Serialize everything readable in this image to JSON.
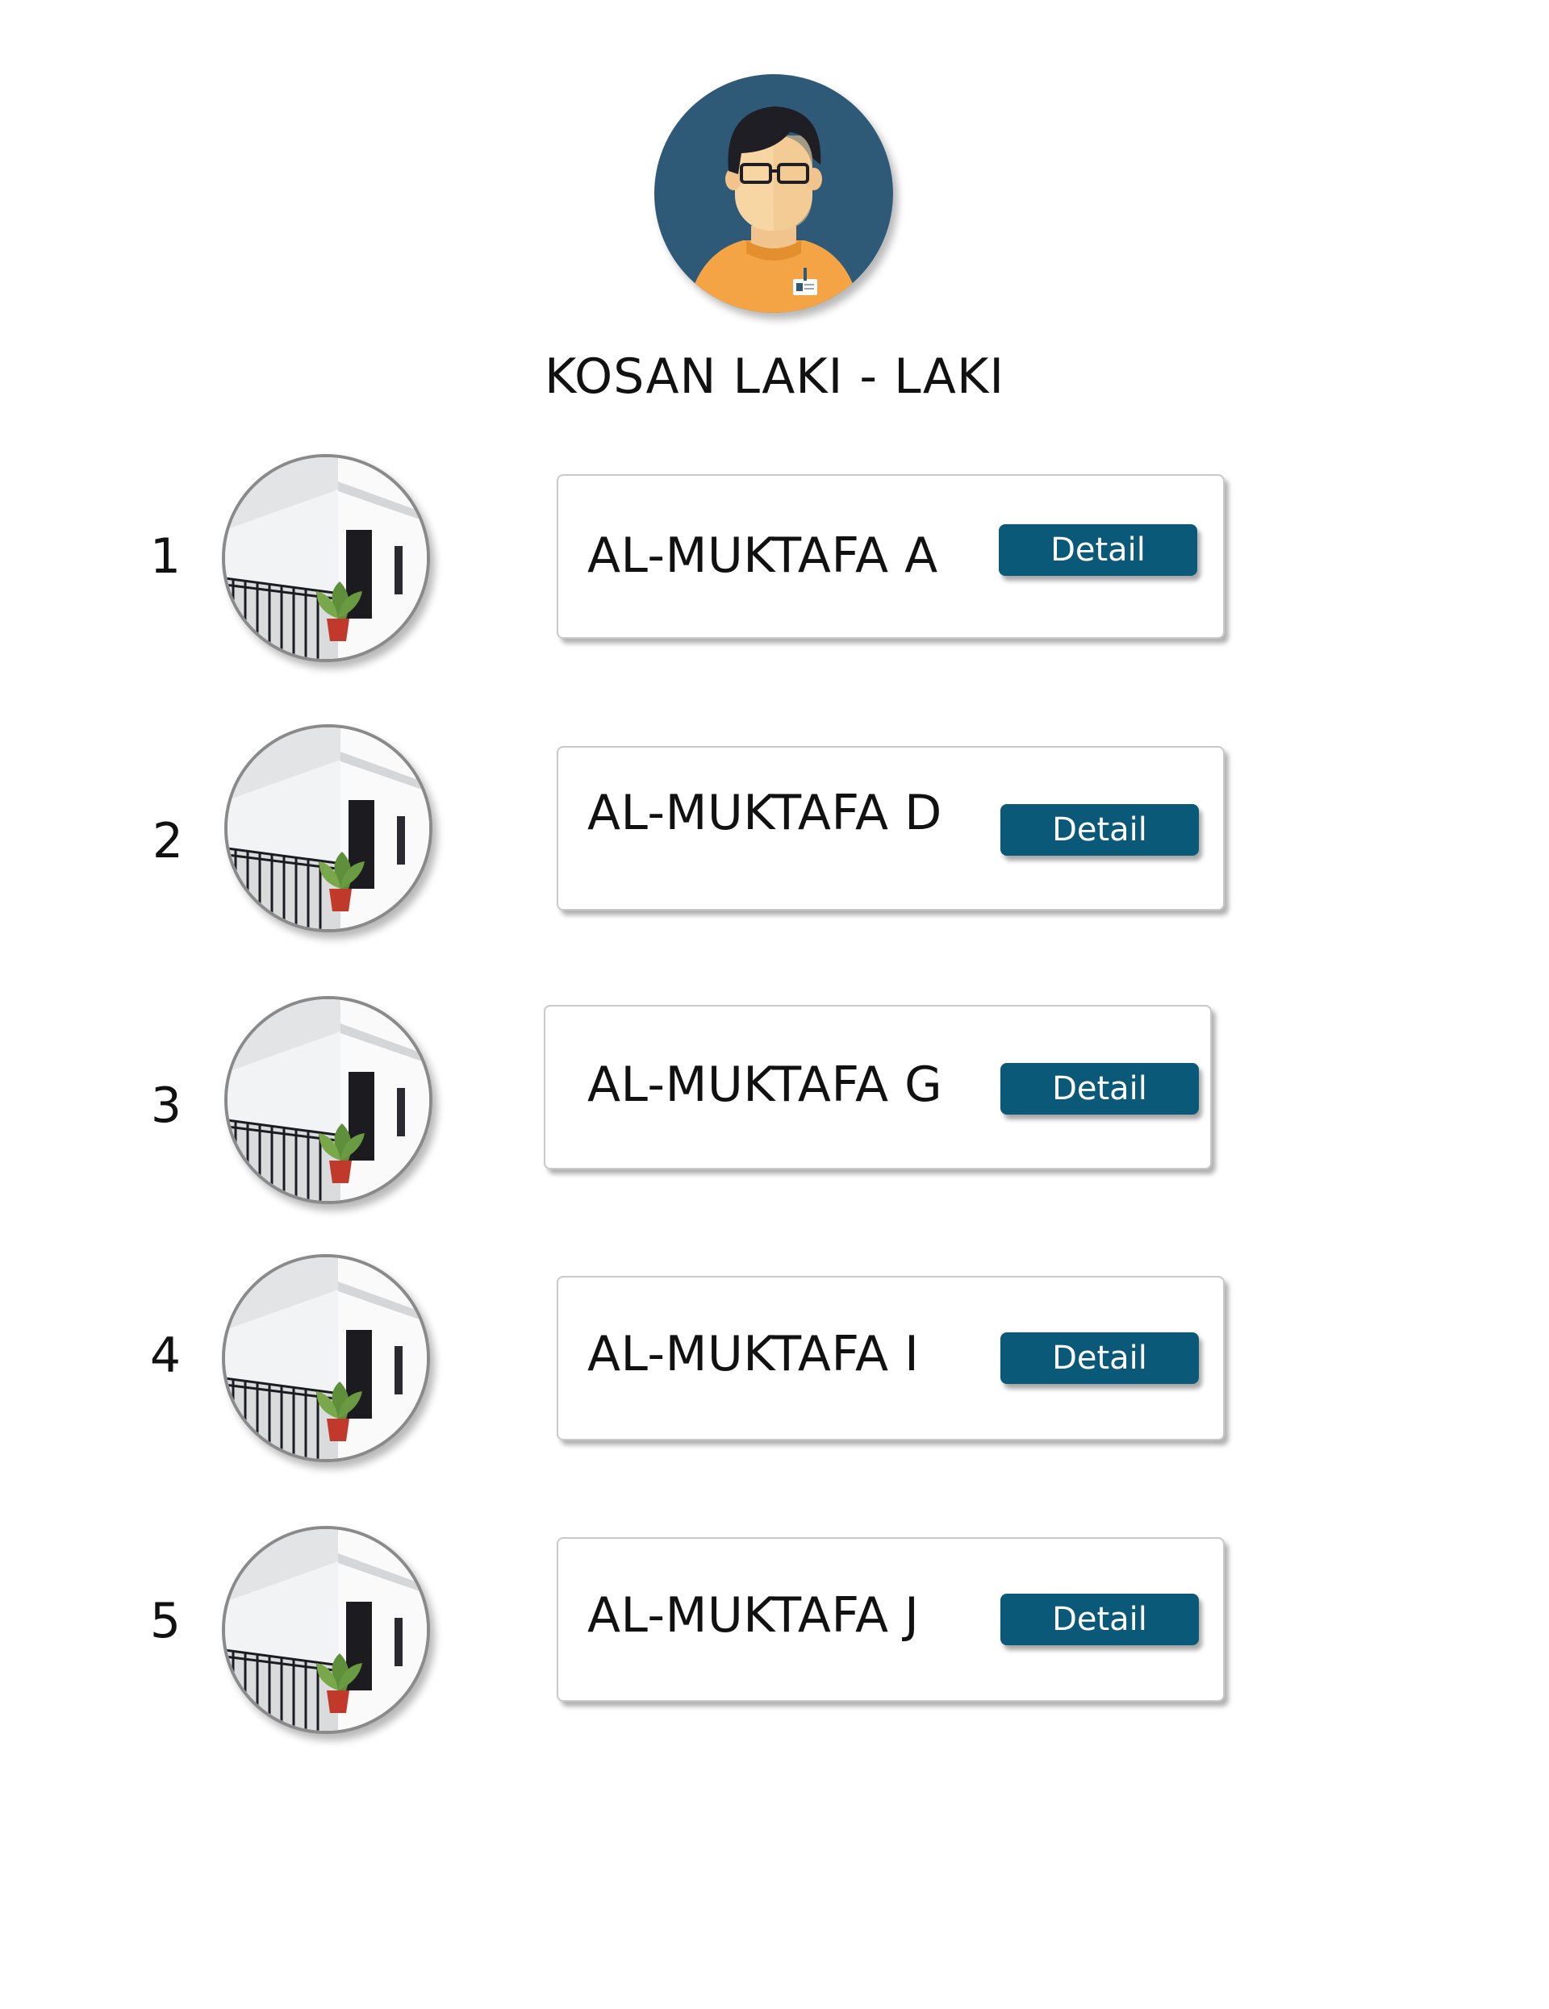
{
  "header": {
    "title": "KOSAN LAKI - LAKI",
    "avatar_icon": "user-avatar-icon"
  },
  "colors": {
    "button_bg": "#0b5978",
    "button_text": "#ffffff",
    "avatar_bg": "#2e5a78",
    "avatar_shirt": "#f5a445"
  },
  "listings": [
    {
      "number": "1",
      "name": "AL-MUKTAFA A",
      "button_label": "Detail"
    },
    {
      "number": "2",
      "name": "AL-MUKTAFA D",
      "button_label": "Detail"
    },
    {
      "number": "3",
      "name": "AL-MUKTAFA G",
      "button_label": "Detail"
    },
    {
      "number": "4",
      "name": "AL-MUKTAFA I",
      "button_label": "Detail"
    },
    {
      "number": "5",
      "name": "AL-MUKTAFA J",
      "button_label": "Detail"
    }
  ]
}
